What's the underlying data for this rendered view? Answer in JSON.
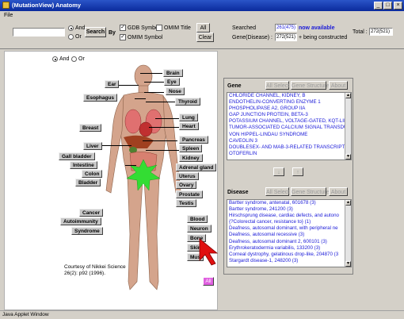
{
  "window": {
    "title": "(MutationView) Anatomy"
  },
  "menu": {
    "file": "File"
  },
  "search": {
    "and": "And",
    "or": "Or",
    "search_button": "Search",
    "by": "By",
    "gdb_symbol": "GDB Symbol",
    "omim_title": "OMIM Title",
    "omim_symbol": "OMIM Symbol",
    "all_button": "All",
    "clear_button": "Clear"
  },
  "stats": {
    "searched_label": "Searched",
    "searched_value": "261(475)",
    "new_available": "now available",
    "gene_disease_label": "Gene(Disease) :",
    "gene_disease_value": "272(521)",
    "being_constructed": "+ being constructed",
    "total_label": "Total :",
    "total_value": "272(521)"
  },
  "anatomy": {
    "and": "And",
    "or": "Or",
    "organs": {
      "brain": "Brain",
      "eye": "Eye",
      "ear": "Ear",
      "nose": "Nose",
      "esophagus": "Esophagus",
      "thyroid": "Thyroid",
      "lung": "Lung",
      "heart": "Heart",
      "breast": "Breast",
      "pancreas": "Pancreas",
      "liver": "Liver",
      "spleen": "Spleen",
      "gall_bladder": "Gall bladder",
      "kidney": "Kidney",
      "intestine": "Intestine",
      "adrenal_gland": "Adrenal gland",
      "colon": "Colon",
      "uterus": "Uterus",
      "bladder": "Bladder",
      "ovary": "Ovary",
      "prostate": "Prostate",
      "testis": "Testis",
      "cancer": "Cancer",
      "blood": "Blood",
      "autoimmunity": "Autoimmunity",
      "neuron": "Neuron",
      "syndrome": "Syndrome",
      "bone": "Bone",
      "skin": "Skin",
      "muscle": "Mus"
    },
    "credit_line1": "Courtesy of Nikkei Science",
    "credit_line2": "26(2): p92 (1996).",
    "all_button": "All"
  },
  "gene_panel": {
    "label": "Gene",
    "all_select": "All Select",
    "gene_structure": "Gene Structure",
    "about": "About",
    "items": [
      "CHLORIDE CHANNEL, KIDNEY, B",
      "ENDOTHELIN-CONVERTING ENZYME 1",
      "PHOSPHOLIPASE A2, GROUP IIA",
      "GAP JUNCTION PROTEIN, BETA-3",
      "POTASSIUM CHANNEL, VOLTAGE-GATED, KQT-LII",
      "TUMOR-ASSOCIATED CALCIUM SIGNAL TRANSDU",
      "VON HIPPEL-LINDAU SYNDROME",
      "CAVEOLIN 3",
      "DOUBLESEX- AND MAB-3-RELATED TRANSCRIPT",
      "OTOFERLIN"
    ],
    "down_arrow": "↓",
    "up_arrow": "↑"
  },
  "disease_panel": {
    "label": "Disease",
    "all_select": "All Select",
    "gene_structure": "Gene Structure",
    "about": "About",
    "items": [
      "Bartter syndrome, antenatal, 601678 (3)",
      "Bartter syndrome, 241200 (3)",
      "Hirschsprung disease, cardiac defects, and autono",
      "{?Colorectal cancer, resistance to} (1)",
      "Deafness, autosomal dominant, with peripheral ne",
      "Deafness, autosomal recessive (3)",
      "Deafness, autosomal dominant 2, 600101 (3)",
      "Erythrokeratodermia variabilis, 133200 (3)",
      "Corneal dystrophy, gelatinous drop-like, 204870 (3",
      "Stargardt disease-1, 248200 (3)"
    ]
  },
  "status_bar": "Java Applet Window",
  "colors": {
    "title_bar": "#0a2a9c",
    "list_text": "#1a1ad8",
    "organ_highlight": "#33dd33",
    "pointer": "#e01010"
  }
}
